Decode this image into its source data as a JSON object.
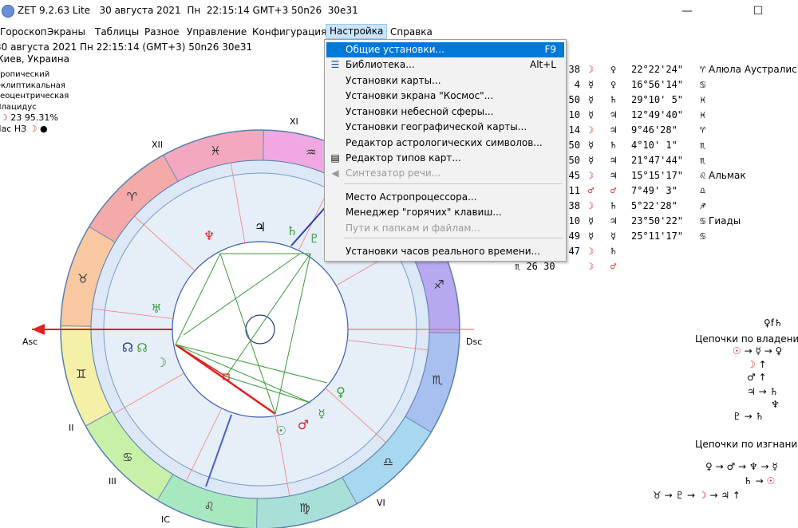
{
  "window": {
    "title": "ZET 9.2.63 Lite   30 августа 2021  Пн  22:15:14 GMT+3 50n26  30e31",
    "minimize": "—",
    "maximize": "☐",
    "close": "✕"
  },
  "menu": [
    "Гороскоп",
    "Экраны",
    "Таблицы",
    "Разное",
    "Управление",
    "Конфигурация",
    "Настройка",
    "Справка"
  ],
  "info": {
    "line1": "30 августа 2021  Пн  22:15:14 (GMT+3) 50n26  30e31",
    "line2": "Киев, Украина",
    "zodiac": "Тропический",
    "coords": "Эклиптикальная",
    "center": "Геоцентрическая",
    "houses": "Плацидус",
    "moon_phase": "23 95.31%",
    "moon_label": "Час НЗ"
  },
  "dropdown": {
    "items": [
      {
        "label": "Общие установки...",
        "shortcut": "F9",
        "highlighted": true,
        "disabled": false,
        "icon": ""
      },
      {
        "label": "Библиотека...",
        "shortcut": "Alt+L",
        "highlighted": false,
        "disabled": false,
        "icon": "library-icon"
      },
      {
        "label": "Установки карты...",
        "shortcut": "",
        "highlighted": false,
        "disabled": false,
        "icon": ""
      },
      {
        "label": "Установки экрана \"Космос\"...",
        "shortcut": "",
        "highlighted": false,
        "disabled": false,
        "icon": ""
      },
      {
        "label": "Установки небесной сферы...",
        "shortcut": "",
        "highlighted": false,
        "disabled": false,
        "icon": ""
      },
      {
        "label": "Установки географической карты...",
        "shortcut": "",
        "highlighted": false,
        "disabled": false,
        "icon": ""
      },
      {
        "label": "Редактор астрологических символов...",
        "shortcut": "",
        "highlighted": false,
        "disabled": false,
        "icon": ""
      },
      {
        "label": "Редактор типов карт...",
        "shortcut": "",
        "highlighted": false,
        "disabled": false,
        "icon": "document-icon"
      },
      {
        "label": "Синтезатор речи...",
        "shortcut": "",
        "highlighted": false,
        "disabled": true,
        "icon": "speaker-icon"
      },
      {
        "label": "Место Астропроцессора...",
        "shortcut": "",
        "highlighted": false,
        "disabled": false,
        "icon": ""
      },
      {
        "label": "Менеджер \"горячих\" клавиш...",
        "shortcut": "",
        "highlighted": false,
        "disabled": false,
        "icon": ""
      },
      {
        "label": "Пути к папкам и файлам...",
        "shortcut": "",
        "highlighted": false,
        "disabled": true,
        "icon": ""
      },
      {
        "label": "Установки часов реального времени...",
        "shortcut": "",
        "highlighted": false,
        "disabled": false,
        "icon": ""
      }
    ]
  },
  "aspects": [
    {
      "deg": "38",
      "p1": "☽",
      "p2": "♀",
      "pos": "22°22'24\"",
      "sign": "♈",
      "star": "Алюла Аустралис"
    },
    {
      "deg": "4",
      "p1": "☿",
      "p2": "♀",
      "pos": "16°56'14\"",
      "sign": "♋",
      "star": ""
    },
    {
      "deg": "50",
      "p1": "☿",
      "p2": "♄",
      "pos": "29°10' 5\"",
      "sign": "♓",
      "star": ""
    },
    {
      "deg": "10",
      "p1": "☿",
      "p2": "♃",
      "pos": "12°49'40\"",
      "sign": "♓",
      "star": ""
    },
    {
      "deg": "14",
      "p1": "☽",
      "p2": "♃",
      "pos": "9°46'28\"",
      "sign": "♈",
      "star": ""
    },
    {
      "deg": "50",
      "p1": "☿",
      "p2": "♄",
      "pos": "4°10' 1\"",
      "sign": "♏",
      "star": ""
    },
    {
      "deg": "50",
      "p1": "☿",
      "p2": "♃",
      "pos": "21°47'44\"",
      "sign": "♏",
      "star": ""
    },
    {
      "deg": "45",
      "p1": "☽",
      "p2": "♃",
      "pos": "15°15'17\"",
      "sign": "♌",
      "star": "Альмак"
    },
    {
      "deg": "11",
      "p1": "♂",
      "p2": "♂",
      "pos": "7°49' 3\"",
      "sign": "♎",
      "star": ""
    },
    {
      "deg": "38",
      "p1": "☽",
      "p2": "♄",
      "pos": "5°22'28\"",
      "sign": "♐",
      "star": ""
    },
    {
      "deg": "10",
      "p1": "☿",
      "p2": "♃",
      "pos": "23°50'22\"",
      "sign": "♋",
      "star": "Гиады"
    },
    {
      "deg": "49",
      "p1": "☿",
      "p2": "☿",
      "pos": "25°11'17\"",
      "sign": "♋",
      "star": ""
    },
    {
      "deg": "47",
      "p1": "☽",
      "p2": "♄",
      "pos": "",
      "sign": "",
      "star": ""
    },
    {
      "deg": "♏ 26 30",
      "p1": "☽",
      "p2": "♂",
      "pos": "",
      "sign": "",
      "star": ""
    }
  ],
  "chains": {
    "rulership_title": "Цепочки по владению",
    "top_glyphs": "♀f♄",
    "exile_title": "Цепочки по изгнанию"
  },
  "wheel": {
    "sign_glyphs": [
      "♈",
      "♉",
      "♊",
      "♋",
      "♌",
      "♍",
      "♎",
      "♏",
      "♐",
      "♑",
      "♒",
      "♓"
    ],
    "house_labels": [
      "Asc",
      "II",
      "III",
      "IC",
      "",
      "VI",
      "Dsc",
      "",
      "",
      "",
      "XI",
      "XII"
    ]
  }
}
